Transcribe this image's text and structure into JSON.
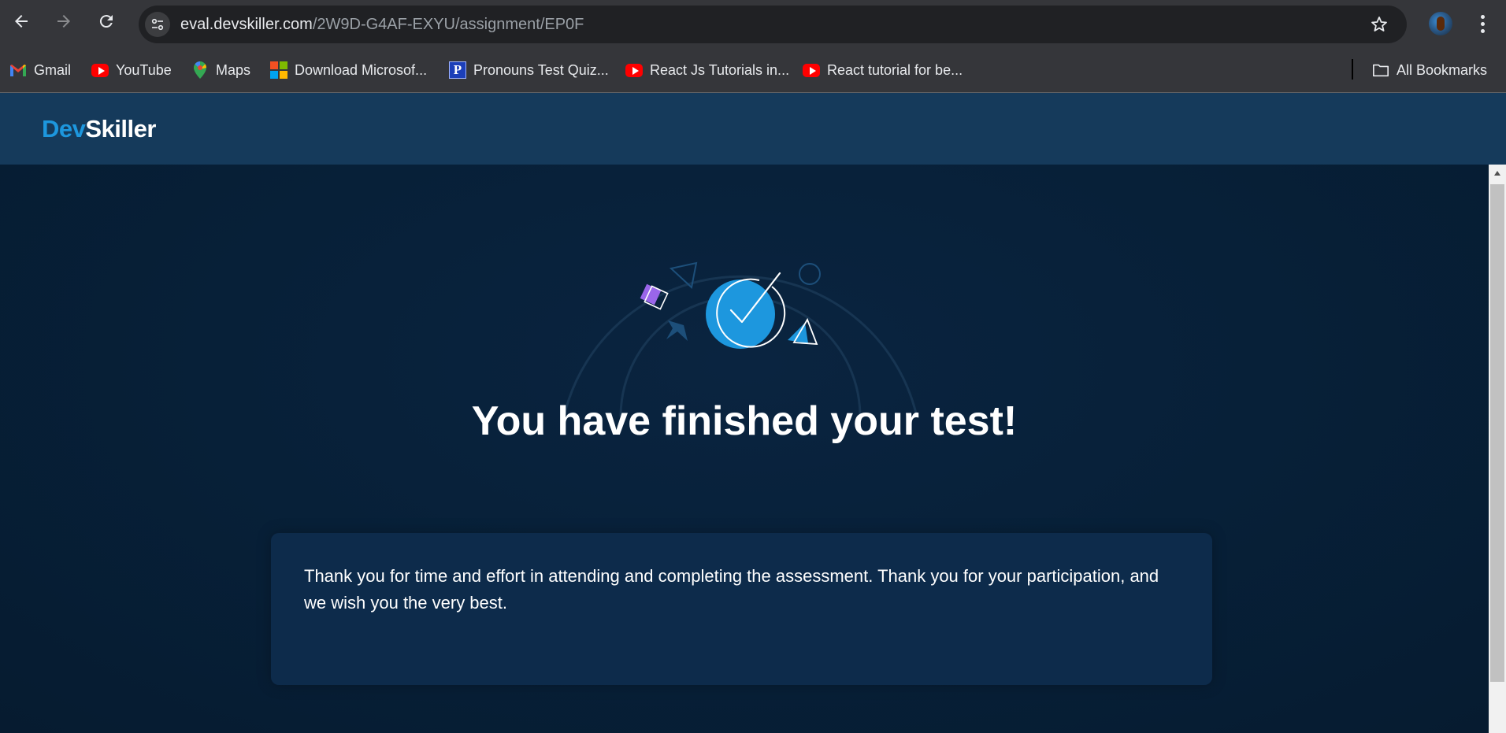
{
  "browser": {
    "url_domain": "eval.devskiller.com",
    "url_path": "/2W9D-G4AF-EXYU/assignment/EP0F",
    "bookmarks": [
      {
        "label": "Gmail",
        "icon": "gmail-icon"
      },
      {
        "label": "YouTube",
        "icon": "youtube-icon"
      },
      {
        "label": "Maps",
        "icon": "maps-icon"
      },
      {
        "label": "Download Microsof...",
        "icon": "microsoft-icon"
      },
      {
        "label": "Pronouns Test Quiz...",
        "icon": "pronouns-p-icon"
      },
      {
        "label": "React Js Tutorials in...",
        "icon": "youtube-icon"
      },
      {
        "label": "React tutorial for be...",
        "icon": "youtube-icon"
      }
    ],
    "all_bookmarks_label": "All Bookmarks"
  },
  "header": {
    "logo_dev": "Dev",
    "logo_skiller": "Skiller"
  },
  "main": {
    "title": "You have finished your test!",
    "message": "Thank you for time and effort in attending and completing the assessment. Thank you for your participation, and we wish you the very best."
  },
  "colors": {
    "header_bg": "#153a5b",
    "page_bg": "#072038",
    "card_bg": "#0d2b4b",
    "accent": "#1d97de"
  }
}
